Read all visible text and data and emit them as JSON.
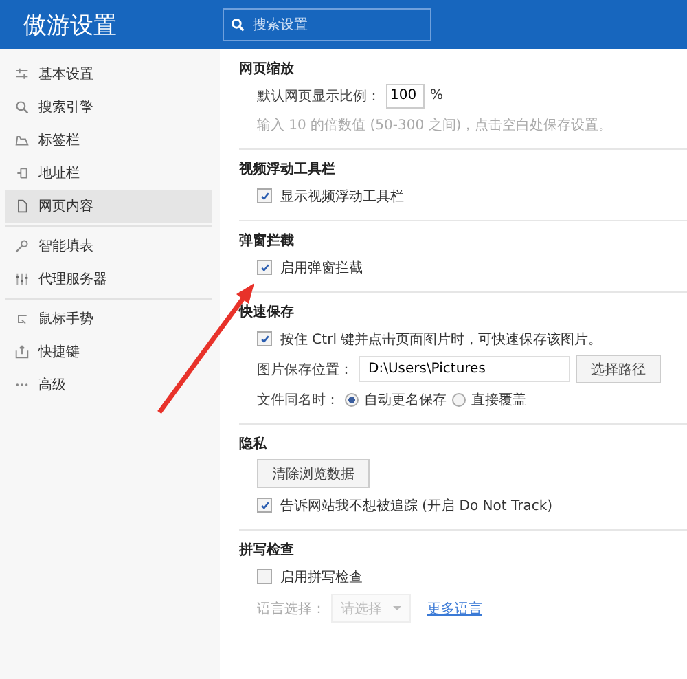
{
  "header": {
    "title": "傲游设置",
    "search": {
      "placeholder": "搜索设置"
    }
  },
  "sidebar": {
    "groups": [
      {
        "items": [
          {
            "label": "基本设置",
            "selected": false
          },
          {
            "label": "搜索引擎",
            "selected": false
          },
          {
            "label": "标签栏",
            "selected": false
          },
          {
            "label": "地址栏",
            "selected": false
          },
          {
            "label": "网页内容",
            "selected": true
          }
        ]
      },
      {
        "items": [
          {
            "label": "智能填表",
            "selected": false
          },
          {
            "label": "代理服务器",
            "selected": false
          }
        ]
      },
      {
        "items": [
          {
            "label": "鼠标手势",
            "selected": false
          },
          {
            "label": "快捷键",
            "selected": false
          },
          {
            "label": "高级",
            "selected": false
          }
        ]
      }
    ]
  },
  "sections": [
    {
      "title": "网页缩放",
      "rows": [
        {
          "kind": "zoom",
          "label": "默认网页显示比例：",
          "value": "100",
          "unit": "%"
        },
        {
          "kind": "hint",
          "text": "输入 10 的倍数值 (50-300 之间)，点击空白处保存设置。"
        }
      ]
    },
    {
      "title": "视频浮动工具栏",
      "rows": [
        {
          "kind": "checkbox",
          "label": "显示视频浮动工具栏",
          "checked": true
        }
      ]
    },
    {
      "title": "弹窗拦截",
      "rows": [
        {
          "kind": "checkbox",
          "label": "启用弹窗拦截",
          "checked": true
        }
      ]
    },
    {
      "title": "快速保存",
      "rows": [
        {
          "kind": "checkbox",
          "label": "按住 Ctrl 键并点击页面图片时，可快速保存该图片。",
          "checked": true
        },
        {
          "kind": "path",
          "label": "图片保存位置：",
          "value": "D:\\Users\\Pictures",
          "button": "选择路径"
        },
        {
          "kind": "radio",
          "label": "文件同名时：",
          "options": [
            {
              "label": "自动更名保存",
              "selected": true
            },
            {
              "label": "直接覆盖",
              "selected": false
            }
          ]
        }
      ]
    },
    {
      "title": "隐私",
      "rows": [
        {
          "kind": "button",
          "label": "清除浏览数据"
        },
        {
          "kind": "checkbox",
          "label": "告诉网站我不想被追踪 (开启 Do Not Track)",
          "checked": true
        }
      ]
    },
    {
      "title": "拼写检查",
      "rows": [
        {
          "kind": "checkbox",
          "label": "启用拼写检查",
          "checked": false
        },
        {
          "kind": "language",
          "label": "语言选择：",
          "select": "请选择",
          "disabled": true,
          "link": "更多语言"
        }
      ]
    }
  ]
}
